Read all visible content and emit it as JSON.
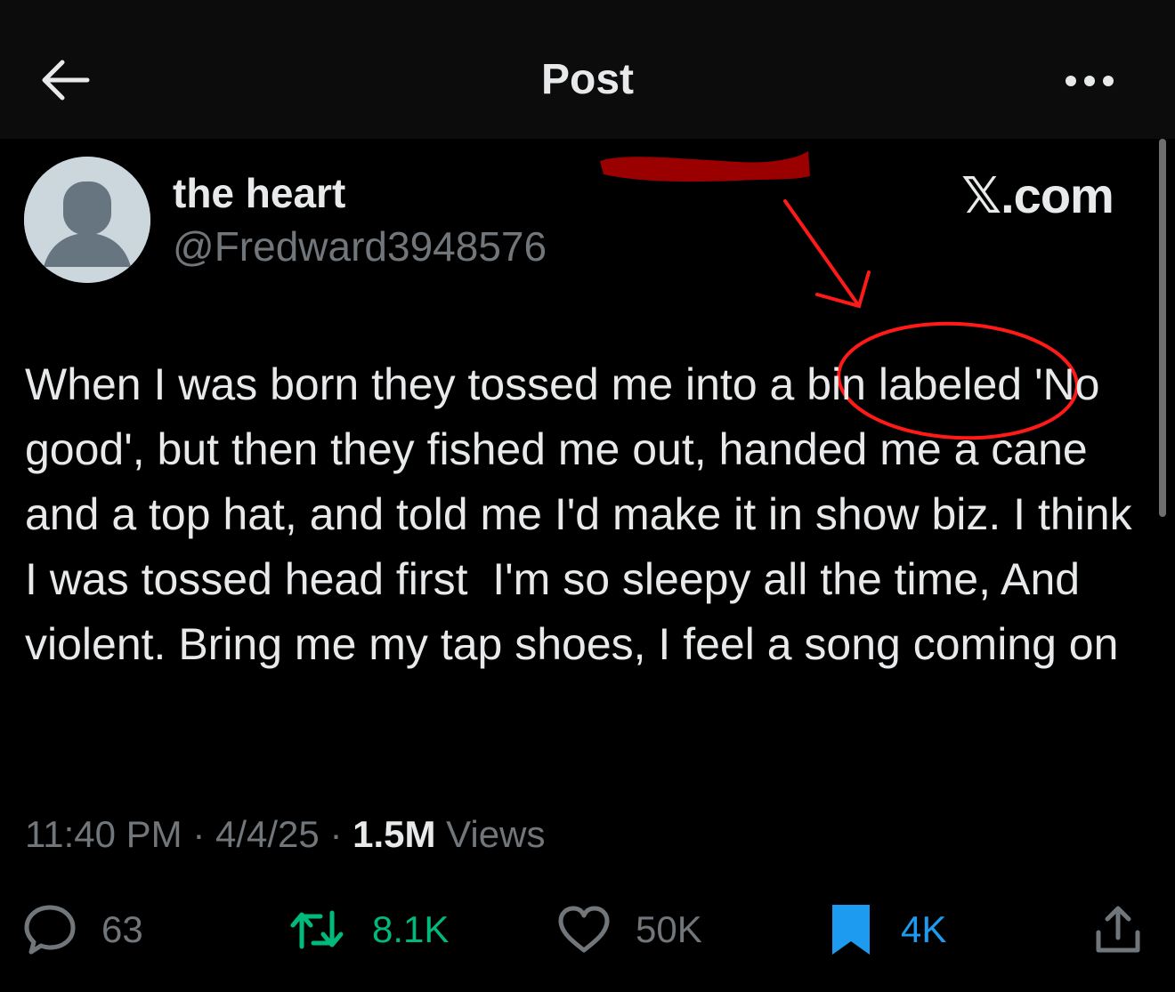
{
  "header": {
    "title": "Post"
  },
  "post": {
    "display_name": "the heart",
    "handle": "@Fredward3948576",
    "text": "When I was born they tossed me into a bin labeled 'No good', but then they fished me out, handed me a cane and a top hat, and told me I'd make it in show biz. I think I was tossed head first  I'm so sleepy all the time, And violent. Bring me my tap shoes, I feel a song coming on",
    "time": "11:40 PM",
    "date": "4/4/25",
    "views_count": "1.5M",
    "views_label": "Views",
    "separator": "·"
  },
  "watermark": "𝕏.com",
  "actions": {
    "replies": "63",
    "reposts": "8.1K",
    "likes": "50K",
    "bookmarks": "4K"
  },
  "colors": {
    "background": "#000000",
    "text": "#e7e9ea",
    "muted": "#71767b",
    "repost_active": "#00ba7c",
    "bookmark_active": "#1d9bf0",
    "annotation": "#ff1a1a",
    "redaction": "#9b0000"
  }
}
